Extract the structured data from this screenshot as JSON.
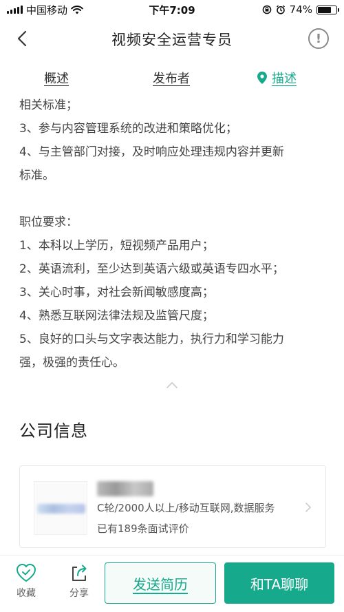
{
  "status_bar": {
    "carrier": "中国移动",
    "time": "下午7:09",
    "battery": "74%",
    "battery_level": 0.74
  },
  "nav": {
    "title": "视频安全运营专员"
  },
  "tabs": [
    {
      "label": "概述"
    },
    {
      "label": "发布者"
    },
    {
      "label": "描述",
      "active": true
    }
  ],
  "description": {
    "lines": [
      "相关标准；",
      "3、参与内容管理系统的改进和策略优化；",
      "4、与主管部门对接，及时响应处理违规内容并更新",
      "标准。",
      "",
      "职位要求：",
      "1、本科以上学历，短视频产品用户；",
      "2、英语流利，至少达到英语六级或英语专四水平；",
      "3、关心时事，对社会新闻敏感度高；",
      "4、熟悉互联网法律法规及监管尺度；",
      "5、良好的口头与文字表达能力，执行力和学习能力",
      "强，极强的责任心。"
    ]
  },
  "company_section": {
    "title": "公司信息",
    "meta": "C轮/2000人以上/移动互联网,数据服务",
    "reviews": "已有189条面试评价"
  },
  "bottom_bar": {
    "favorite_label": "收藏",
    "share_label": "分享",
    "send_resume_label": "发送简历",
    "chat_label": "和TA聊聊"
  },
  "colors": {
    "accent": "#17a98b"
  }
}
